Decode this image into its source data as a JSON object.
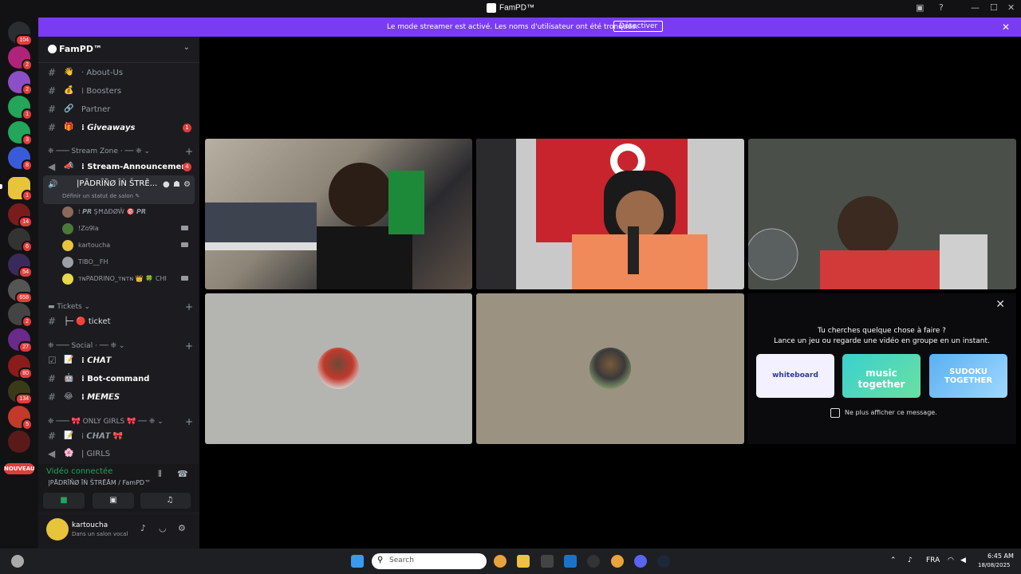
{
  "window": {
    "title": "FamPD™"
  },
  "banner": {
    "message": "Le mode streamer est activé. Les noms d'utilisateur ont été tronqués.",
    "button": "Désactiver",
    "close": "✕"
  },
  "servers": {
    "badges": [
      "104",
      "2",
      "2",
      "1",
      "3",
      "8",
      "1",
      "14",
      "6",
      "54",
      "658",
      "2",
      "27",
      "80",
      "134",
      "5"
    ],
    "new_label": "NOUVEAU"
  },
  "server_header": {
    "name": "FamPD™"
  },
  "channels": [
    {
      "emoji": "👋",
      "name": "· About-Us"
    },
    {
      "emoji": "💰",
      "name": "⁞ Boosters"
    },
    {
      "emoji": "🔗",
      "name": "Partner"
    },
    {
      "emoji": "🎁",
      "name": "⁞ 𝙂𝙞𝙫𝙚𝙖𝙬𝙖𝙮𝙨",
      "badge": "1"
    }
  ],
  "categories": {
    "stream_zone": "❈ ─── Stream Zone · ── ❈ ⌄",
    "tickets": "▬ Tickets ⌄",
    "social": "❈ ─── Social · ── ❈ ⌄",
    "only_girls": "❈ ─── 🎀 ONLY GIRLS 🎀 ── ❈ ⌄"
  },
  "stream_channels": [
    {
      "emoji": "📣",
      "name": "⁞ Stream-Announcement",
      "badge": "4"
    }
  ],
  "voice_channel": {
    "name": "|PĀDRĪÑØ ĪŃ ŠTRĒ...",
    "status": "Définir un statut de salon ✎"
  },
  "voice_users": [
    {
      "name": "⁞ 𝙋𝙍 ŞĦΔĐØŴ 🎯 𝙋𝙍",
      "color": "#8a6a5a"
    },
    {
      "name": "!Zo9la",
      "color": "#4a7a3a"
    },
    {
      "name": "kartoucha",
      "color": "#e8c33c"
    },
    {
      "name": "TIBO__FH",
      "color": "#9aa0a6"
    },
    {
      "name": "ᴛɴPADRINO_ᴛɴᴛɴ 👑 🍀 CHI",
      "color": "#e8d84a"
    }
  ],
  "ticket_channels": [
    {
      "name": "├─ 🔴 ticket"
    }
  ],
  "social_channels": [
    {
      "emoji": "📝",
      "name": "⁞ 𝘾𝙃𝘼𝙏"
    },
    {
      "emoji": "🤖",
      "name": "⁞ Bot-command"
    },
    {
      "emoji": "😂",
      "name": "⁞ 𝙈𝙀𝙈𝙀𝙎"
    }
  ],
  "girls_channels": [
    {
      "emoji": "📝",
      "name": "⁞ 𝘾𝙃𝘼𝙏 🎀"
    },
    {
      "emoji": "🌸",
      "name": "| GIRLS"
    }
  ],
  "voice_panel": {
    "status": "Vidéo connectée",
    "channel": "|PĀDRĪÑØ ĪŃ ŠTRĒĀM / FamPD™"
  },
  "user": {
    "name": "kartoucha",
    "status": "Dans un salon vocal"
  },
  "activity_panel": {
    "line1": "Tu cherches quelque chose à faire ?",
    "line2": "Lance un jeu ou regarde une vidéo en groupe en un instant.",
    "activities": [
      "whiteboard",
      "music together",
      "SUDOKU TOGETHER"
    ],
    "checkbox_label": "Ne plus afficher ce message."
  },
  "taskbar": {
    "search": "Search",
    "lang": "FRA",
    "time": "6:45 AM",
    "date": "18/08/2025"
  }
}
